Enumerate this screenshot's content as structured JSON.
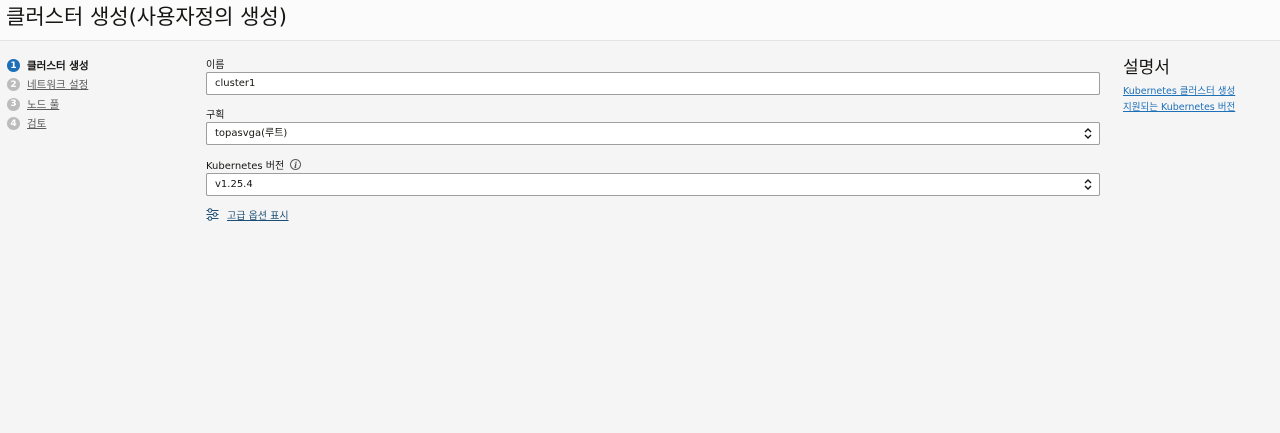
{
  "header": {
    "title": "클러스터 생성(사용자정의 생성)"
  },
  "steps": [
    {
      "number": "1",
      "label": "클러스터 생성",
      "active": true
    },
    {
      "number": "2",
      "label": "네트워크 설정",
      "active": false
    },
    {
      "number": "3",
      "label": "노드 풀",
      "active": false
    },
    {
      "number": "4",
      "label": "검토",
      "active": false
    }
  ],
  "form": {
    "name_label": "이름",
    "name_value": "cluster1",
    "compartment_label": "구획",
    "compartment_value": "topasvga(루트)",
    "k8s_version_label": "Kubernetes 버전",
    "k8s_version_value": "v1.25.4",
    "advanced_label": "고급 옵션 표시"
  },
  "help": {
    "title": "설명서",
    "links": [
      "Kubernetes 클러스터 생성",
      "지원되는 Kubernetes 버전"
    ]
  },
  "icons": {
    "info": "info-icon",
    "select": "select-arrows-icon",
    "advanced": "sliders-icon"
  },
  "colors": {
    "accent": "#1d6fb8",
    "link": "#1d4f76"
  }
}
